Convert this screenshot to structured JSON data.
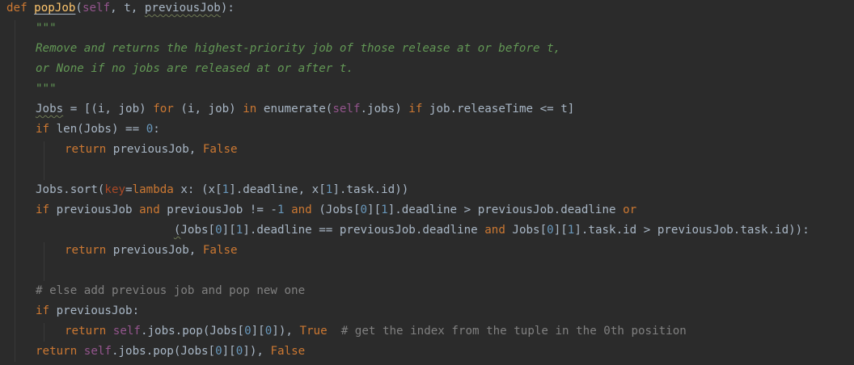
{
  "code_lines": [
    {
      "indent": 0,
      "tokens": [
        {
          "t": "def ",
          "c": "kw"
        },
        {
          "t": "popJob",
          "c": "fn",
          "u": "plain"
        },
        {
          "t": "(",
          "c": "tx"
        },
        {
          "t": "self",
          "c": "self"
        },
        {
          "t": ", t, ",
          "c": "tx"
        },
        {
          "t": "previousJob",
          "c": "tx",
          "u": "wavy"
        },
        {
          "t": "):",
          "c": "tx"
        }
      ]
    },
    {
      "indent": 1,
      "tokens": [
        {
          "t": "\"\"\"",
          "c": "doc"
        }
      ]
    },
    {
      "indent": 1,
      "tokens": [
        {
          "t": "Remove and returns the highest-priority job of those release at or before t,",
          "c": "doc"
        }
      ]
    },
    {
      "indent": 1,
      "tokens": [
        {
          "t": "or None if no jobs are released at or after t.",
          "c": "doc"
        }
      ]
    },
    {
      "indent": 1,
      "tokens": [
        {
          "t": "\"\"\"",
          "c": "doc"
        }
      ]
    },
    {
      "indent": 1,
      "tokens": [
        {
          "t": "Jobs",
          "c": "tx",
          "u": "wavy"
        },
        {
          "t": " = [(i, job) ",
          "c": "tx"
        },
        {
          "t": "for",
          "c": "kw"
        },
        {
          "t": " (i, job) ",
          "c": "tx"
        },
        {
          "t": "in",
          "c": "kw"
        },
        {
          "t": " enumerate(",
          "c": "tx"
        },
        {
          "t": "self",
          "c": "self"
        },
        {
          "t": ".jobs) ",
          "c": "tx"
        },
        {
          "t": "if",
          "c": "kw"
        },
        {
          "t": " job.releaseTime <= t]",
          "c": "tx"
        }
      ]
    },
    {
      "indent": 1,
      "tokens": [
        {
          "t": "if",
          "c": "kw"
        },
        {
          "t": " len(Jobs) == ",
          "c": "tx"
        },
        {
          "t": "0",
          "c": "num"
        },
        {
          "t": ":",
          "c": "tx"
        }
      ]
    },
    {
      "indent": 2,
      "tokens": [
        {
          "t": "return",
          "c": "kw"
        },
        {
          "t": " previousJob, ",
          "c": "tx"
        },
        {
          "t": "False",
          "c": "kw"
        }
      ]
    },
    {
      "indent": 0,
      "tokens": []
    },
    {
      "indent": 1,
      "tokens": [
        {
          "t": "Jobs.sort(",
          "c": "tx"
        },
        {
          "t": "key",
          "c": "param"
        },
        {
          "t": "=",
          "c": "tx"
        },
        {
          "t": "lambda",
          "c": "kw"
        },
        {
          "t": " x: (x[",
          "c": "tx"
        },
        {
          "t": "1",
          "c": "num"
        },
        {
          "t": "].deadline, x[",
          "c": "tx"
        },
        {
          "t": "1",
          "c": "num"
        },
        {
          "t": "].task.id))",
          "c": "tx"
        }
      ]
    },
    {
      "indent": 1,
      "tokens": [
        {
          "t": "if",
          "c": "kw"
        },
        {
          "t": " previousJob ",
          "c": "tx"
        },
        {
          "t": "and",
          "c": "kw"
        },
        {
          "t": " previousJob != -",
          "c": "tx"
        },
        {
          "t": "1",
          "c": "num"
        },
        {
          "t": " ",
          "c": "tx"
        },
        {
          "t": "and",
          "c": "kw"
        },
        {
          "t": " (Jobs[",
          "c": "tx"
        },
        {
          "t": "0",
          "c": "num"
        },
        {
          "t": "][",
          "c": "tx"
        },
        {
          "t": "1",
          "c": "num"
        },
        {
          "t": "].deadline > previousJob.deadline ",
          "c": "tx"
        },
        {
          "t": "or",
          "c": "kw"
        }
      ]
    },
    {
      "indent": 1,
      "tokens": [
        {
          "t": "                    ",
          "c": "tx"
        },
        {
          "t": "(",
          "c": "tx",
          "u": "wavy"
        },
        {
          "t": "Jobs[",
          "c": "tx"
        },
        {
          "t": "0",
          "c": "num"
        },
        {
          "t": "][",
          "c": "tx"
        },
        {
          "t": "1",
          "c": "num"
        },
        {
          "t": "].deadline == previousJob.deadline ",
          "c": "tx"
        },
        {
          "t": "and",
          "c": "kw"
        },
        {
          "t": " Jobs[",
          "c": "tx"
        },
        {
          "t": "0",
          "c": "num"
        },
        {
          "t": "][",
          "c": "tx"
        },
        {
          "t": "1",
          "c": "num"
        },
        {
          "t": "].task.id > previousJob.task.id)):",
          "c": "tx"
        }
      ]
    },
    {
      "indent": 2,
      "tokens": [
        {
          "t": "return",
          "c": "kw"
        },
        {
          "t": " previousJob, ",
          "c": "tx"
        },
        {
          "t": "False",
          "c": "kw"
        }
      ]
    },
    {
      "indent": 0,
      "tokens": []
    },
    {
      "indent": 1,
      "tokens": [
        {
          "t": "# else add previous job and pop new one",
          "c": "cmt"
        }
      ]
    },
    {
      "indent": 1,
      "tokens": [
        {
          "t": "if",
          "c": "kw"
        },
        {
          "t": " previousJob:",
          "c": "tx"
        }
      ]
    },
    {
      "indent": 2,
      "tokens": [
        {
          "t": "return",
          "c": "kw"
        },
        {
          "t": " ",
          "c": "tx"
        },
        {
          "t": "self",
          "c": "self"
        },
        {
          "t": ".jobs.pop(Jobs[",
          "c": "tx"
        },
        {
          "t": "0",
          "c": "num"
        },
        {
          "t": "][",
          "c": "tx"
        },
        {
          "t": "0",
          "c": "num"
        },
        {
          "t": "]), ",
          "c": "tx"
        },
        {
          "t": "True",
          "c": "kw"
        },
        {
          "t": "  ",
          "c": "tx"
        },
        {
          "t": "# get the index from the tuple in the 0th position",
          "c": "cmt"
        }
      ]
    },
    {
      "indent": 1,
      "tokens": [
        {
          "t": "return",
          "c": "kw"
        },
        {
          "t": " ",
          "c": "tx"
        },
        {
          "t": "self",
          "c": "self"
        },
        {
          "t": ".jobs.pop(Jobs[",
          "c": "tx"
        },
        {
          "t": "0",
          "c": "num"
        },
        {
          "t": "][",
          "c": "tx"
        },
        {
          "t": "0",
          "c": "num"
        },
        {
          "t": "]), ",
          "c": "tx"
        },
        {
          "t": "False",
          "c": "kw"
        }
      ]
    }
  ]
}
